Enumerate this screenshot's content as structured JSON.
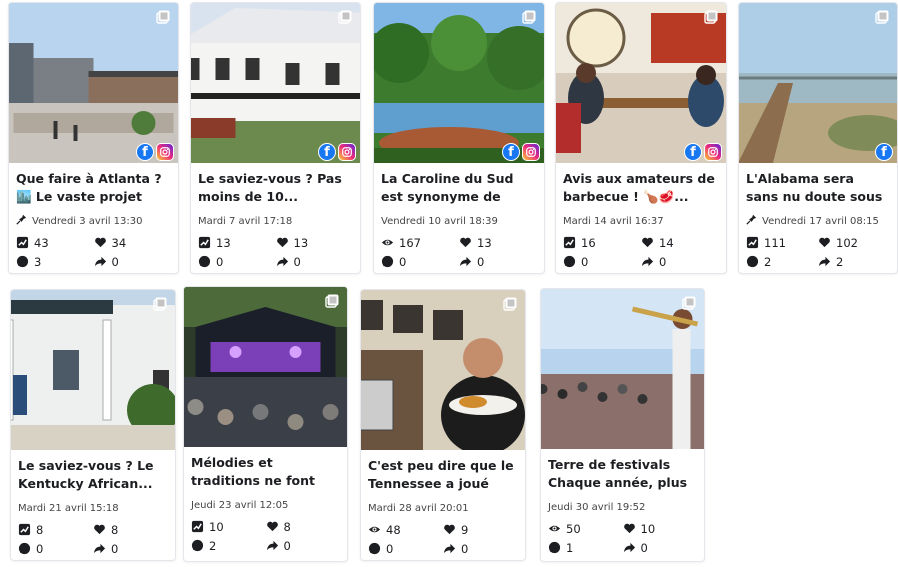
{
  "posts": [
    {
      "title": "Que faire à Atlanta ? 🏙️ Le vaste projet de...",
      "date": "Vendredi 3 avril 13:30",
      "scheduled": true,
      "reach_icon": "trend-icon",
      "reach": "43",
      "likes": "34",
      "comments": "3",
      "shares": "0",
      "platforms": [
        "facebook",
        "instagram"
      ],
      "type_icon": "album-icon"
    },
    {
      "title": "Le saviez-vous ? Pas moins de 10...",
      "date": "Mardi 7 avril 17:18",
      "scheduled": false,
      "reach_icon": "trend-icon",
      "reach": "13",
      "likes": "13",
      "comments": "0",
      "shares": "0",
      "platforms": [
        "facebook",
        "instagram"
      ],
      "type_icon": "album-icon"
    },
    {
      "title": "La Caroline du Sud est synonyme de paysag...",
      "date": "Vendredi 10 avril 18:39",
      "scheduled": false,
      "reach_icon": "eye-icon",
      "reach": "167",
      "likes": "13",
      "comments": "0",
      "shares": "0",
      "platforms": [
        "facebook",
        "instagram"
      ],
      "type_icon": "album-icon"
    },
    {
      "title": "Avis aux amateurs de barbecue ! 🍗🥩...",
      "date": "Mardi 14 avril 16:37",
      "scheduled": false,
      "reach_icon": "trend-icon",
      "reach": "16",
      "likes": "14",
      "comments": "0",
      "shares": "0",
      "platforms": [
        "facebook",
        "instagram"
      ],
      "type_icon": "album-icon"
    },
    {
      "title": "L'Alabama sera sans nu doute sous les feux d...",
      "date": "Vendredi 17 avril 08:15",
      "scheduled": true,
      "reach_icon": "trend-icon",
      "reach": "111",
      "likes": "102",
      "comments": "2",
      "shares": "2",
      "platforms": [
        "facebook"
      ],
      "type_icon": "album-icon"
    },
    {
      "title": "Le saviez-vous ? Le Kentucky African...",
      "date": "Mardi 21 avril 15:18",
      "scheduled": false,
      "reach_icon": "trend-icon",
      "reach": "8",
      "likes": "8",
      "comments": "0",
      "shares": "0",
      "platforms": [],
      "type_icon": "album-icon"
    },
    {
      "title": "Mélodies et traditions ne font qu'une lorsqu...",
      "date": "Jeudi 23 avril 12:05",
      "scheduled": false,
      "reach_icon": "trend-icon",
      "reach": "10",
      "likes": "8",
      "comments": "2",
      "shares": "0",
      "platforms": [],
      "type_icon": "album-icon"
    },
    {
      "title": "C'est peu dire que le Tennessee a joué un...",
      "date": "Mardi 28 avril 20:01",
      "scheduled": false,
      "reach_icon": "eye-icon",
      "reach": "48",
      "likes": "9",
      "comments": "0",
      "shares": "0",
      "platforms": [],
      "type_icon": "album-icon"
    },
    {
      "title": "Terre de festivals Chaque année, plus d...",
      "date": "Jeudi 30 avril 19:52",
      "scheduled": false,
      "reach_icon": "eye-icon",
      "reach": "50",
      "likes": "10",
      "comments": "1",
      "shares": "0",
      "platforms": [],
      "type_icon": "album-icon"
    }
  ],
  "colors": {
    "facebook": "#1877f2",
    "icon": "#1c1e21",
    "border": "#e4e6eb"
  }
}
